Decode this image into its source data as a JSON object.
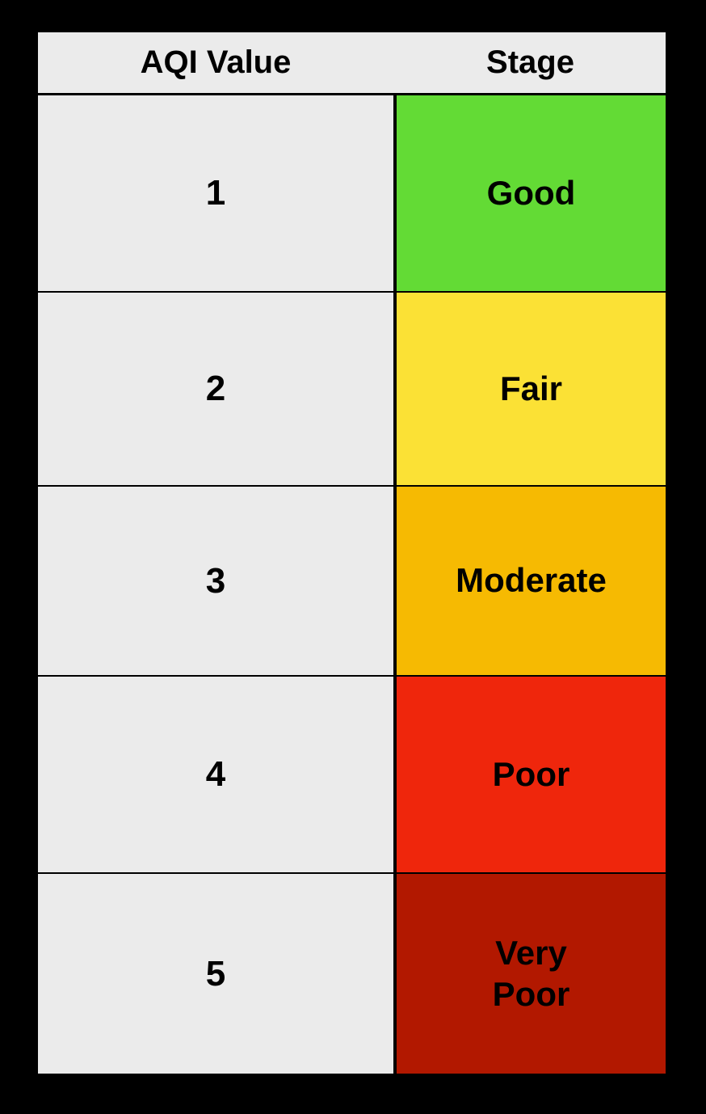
{
  "table": {
    "headers": {
      "value": "AQI Value",
      "stage": "Stage"
    },
    "rows": [
      {
        "value": "1",
        "stage": "Good",
        "color": "#63db35"
      },
      {
        "value": "2",
        "stage": "Fair",
        "color": "#fbe135"
      },
      {
        "value": "3",
        "stage": "Moderate",
        "color": "#f6ba02"
      },
      {
        "value": "4",
        "stage": "Poor",
        "color": "#ef260c"
      },
      {
        "value": "5",
        "stage": "Very\nPoor",
        "color": "#b21800"
      }
    ]
  }
}
